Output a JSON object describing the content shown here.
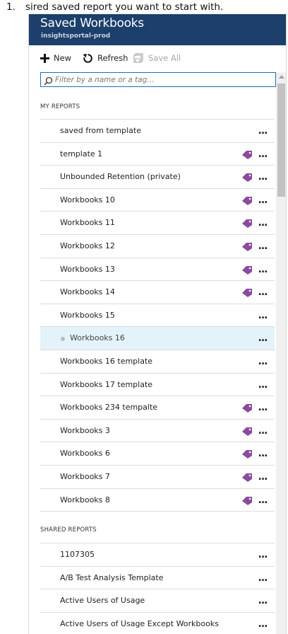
{
  "doc": {
    "number": "1.",
    "text": "sired saved report you want to start with."
  },
  "blade": {
    "title": "Saved Workbooks",
    "subtitle": "insightsportal-prod"
  },
  "toolbar": {
    "new_label": "New",
    "refresh_label": "Refresh",
    "save_all_label": "Save All"
  },
  "search": {
    "placeholder": "Filter by a name or a tag...",
    "value": ""
  },
  "sections": {
    "my_reports": "MY REPORTS",
    "shared_reports": "SHARED REPORTS"
  },
  "my_reports": [
    {
      "name": "saved from template",
      "tagged": false,
      "selected": false
    },
    {
      "name": "template 1",
      "tagged": true,
      "selected": false
    },
    {
      "name": "Unbounded Retention (private)",
      "tagged": true,
      "selected": false
    },
    {
      "name": "Workbooks 10",
      "tagged": true,
      "selected": false
    },
    {
      "name": "Workbooks 11",
      "tagged": true,
      "selected": false
    },
    {
      "name": "Workbooks 12",
      "tagged": true,
      "selected": false
    },
    {
      "name": "Workbooks 13",
      "tagged": true,
      "selected": false
    },
    {
      "name": "Workbooks 14",
      "tagged": true,
      "selected": false
    },
    {
      "name": "Workbooks 15",
      "tagged": false,
      "selected": false
    },
    {
      "name": "Workbooks 16",
      "tagged": false,
      "selected": true
    },
    {
      "name": "Workbooks 16 template",
      "tagged": false,
      "selected": false
    },
    {
      "name": "Workbooks 17 template",
      "tagged": false,
      "selected": false
    },
    {
      "name": "Workbooks 234 tempalte",
      "tagged": true,
      "selected": false
    },
    {
      "name": "Workbooks 3",
      "tagged": true,
      "selected": false
    },
    {
      "name": "Workbooks 6",
      "tagged": true,
      "selected": false
    },
    {
      "name": "Workbooks 7",
      "tagged": true,
      "selected": false
    },
    {
      "name": "Workbooks 8",
      "tagged": true,
      "selected": false
    }
  ],
  "shared_reports": [
    {
      "name": "1107305",
      "tagged": false
    },
    {
      "name": "A/B Test Analysis Template",
      "tagged": false
    },
    {
      "name": "Active Users of Usage",
      "tagged": false
    },
    {
      "name": "Active Users of Usage Except Workbooks",
      "tagged": false
    }
  ],
  "more_glyph": "...",
  "colors": {
    "header_bg": "#1c3f6b",
    "tag": "#8a4a9e",
    "selected_row": "#e3f3f9",
    "search_border": "#1c6fb5"
  },
  "icons": {
    "new": "plus-icon",
    "refresh": "refresh-icon",
    "save_all": "save-all-icon",
    "search": "search-icon",
    "tag": "tag-icon",
    "more": "more-icon"
  }
}
